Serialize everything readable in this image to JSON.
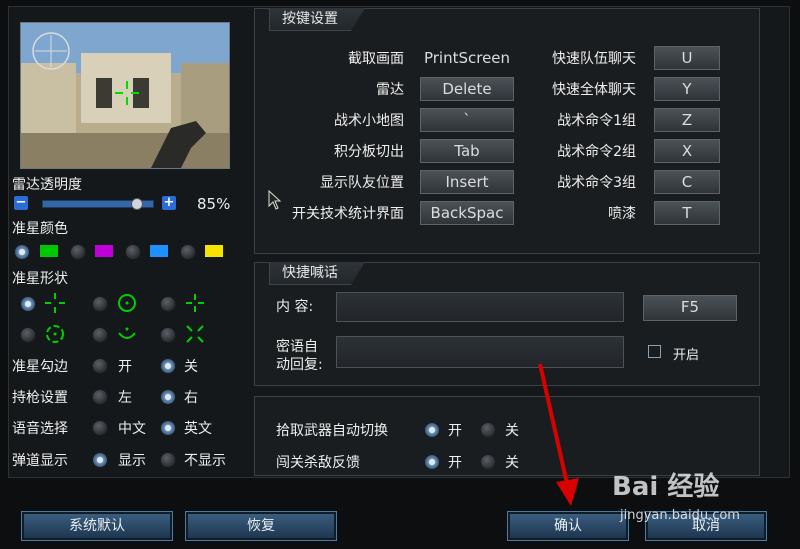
{
  "left": {
    "radar_opacity_label": "雷达透明度",
    "radar_opacity_value": "85%",
    "radar_opacity_fraction": 0.85,
    "crosshair_color_label": "准星颜色",
    "crosshair_colors": [
      "#00c800",
      "#c000d8",
      "#1e90ff",
      "#f4e400"
    ],
    "crosshair_shape_label": "准星形状",
    "outline_label": "准星勾边",
    "outline_on": "开",
    "outline_off": "关",
    "gun_label": "持枪设置",
    "gun_left": "左",
    "gun_right": "右",
    "voice_label": "语音选择",
    "voice_cn": "中文",
    "voice_en": "英文",
    "trajectory_label": "弹道显示",
    "trajectory_show": "显示",
    "trajectory_hide": "不显示"
  },
  "keys": {
    "title": "按键设置",
    "left_rows": [
      {
        "label": "截取画面",
        "key": "PrintScreen"
      },
      {
        "label": "雷达",
        "key": "Delete"
      },
      {
        "label": "战术小地图",
        "key": "`"
      },
      {
        "label": "积分板切出",
        "key": "Tab"
      },
      {
        "label": "显示队友位置",
        "key": "Insert"
      },
      {
        "label": "开关技术统计界面",
        "key": "BackSpac"
      }
    ],
    "right_rows": [
      {
        "label": "快速队伍聊天",
        "key": "U"
      },
      {
        "label": "快速全体聊天",
        "key": "Y"
      },
      {
        "label": "战术命令1组",
        "key": "Z"
      },
      {
        "label": "战术命令2组",
        "key": "X"
      },
      {
        "label": "战术命令3组",
        "key": "C"
      },
      {
        "label": "喷漆",
        "key": "T"
      }
    ]
  },
  "shout": {
    "title": "快捷喊话",
    "content_label": "内  容:",
    "content_key": "F5",
    "auto_reply_label_1": "密语自",
    "auto_reply_label_2": "动回复:",
    "enable_label": "开启"
  },
  "misc": {
    "auto_switch_label": "拾取武器自动切换",
    "auto_switch_on": "开",
    "auto_switch_off": "关",
    "kill_feedback_label": "闯关杀敌反馈",
    "kill_feedback_on": "开",
    "kill_feedback_off": "关"
  },
  "buttons": {
    "default": "系统默认",
    "restore": "恢复",
    "confirm": "确认",
    "cancel": "取消"
  },
  "watermark": {
    "logo_text": "Bai 经验",
    "url": "jingyan.baidu.com"
  }
}
